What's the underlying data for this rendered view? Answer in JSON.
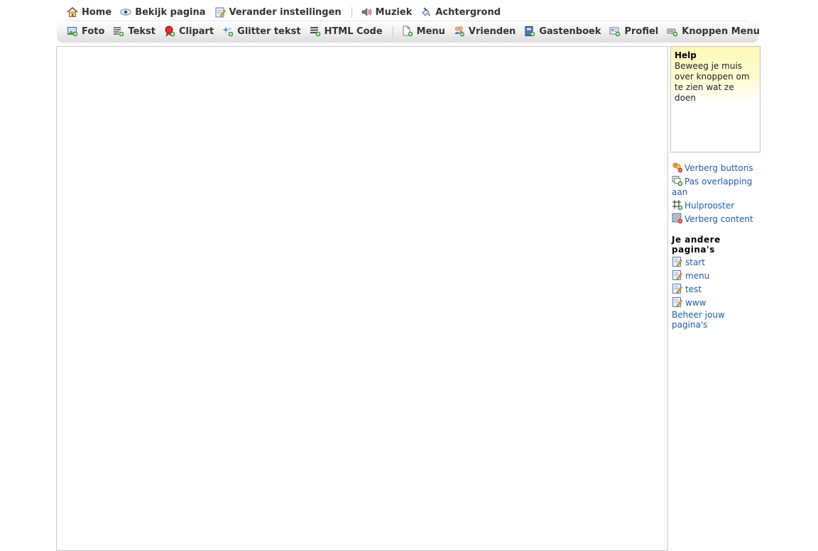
{
  "toolbar": {
    "row1": [
      {
        "label": "Home",
        "icon": "home-icon"
      },
      {
        "label": "Bekijk pagina",
        "icon": "eye-icon"
      },
      {
        "label": "Verander instellingen",
        "icon": "edit-icon"
      },
      {
        "label": "Muziek",
        "icon": "speaker-icon"
      },
      {
        "label": "Achtergrond",
        "icon": "paint-icon"
      }
    ],
    "row2": [
      {
        "label": "Foto",
        "icon": "photo-icon"
      },
      {
        "label": "Tekst",
        "icon": "text-icon"
      },
      {
        "label": "Clipart",
        "icon": "clipart-icon"
      },
      {
        "label": "Glitter tekst",
        "icon": "glitter-icon"
      },
      {
        "label": "HTML Code",
        "icon": "code-icon"
      },
      {
        "label": "Menu",
        "icon": "menu-icon"
      },
      {
        "label": "Vrienden",
        "icon": "friends-icon"
      },
      {
        "label": "Gastenboek",
        "icon": "guestbook-icon"
      },
      {
        "label": "Profiel",
        "icon": "profile-icon"
      },
      {
        "label": "Knoppen Menu",
        "icon": "buttons-menu-icon"
      }
    ]
  },
  "help": {
    "title": "Help",
    "text": "Beweeg je muis over knoppen om te zien wat ze doen"
  },
  "tools": {
    "hide_buttons": "Verberg buttons",
    "overlap": "Pas overlapping aan",
    "grid": "Hulprooster",
    "hide_content": "Verberg content"
  },
  "pages": {
    "title": "Je andere pagina's",
    "items": [
      "start",
      "menu",
      "test",
      "www"
    ],
    "manage": "Beheer jouw pagina's"
  },
  "colors": {
    "link": "#1f5da8",
    "help_bg": "#fff9b8",
    "toolbar_text": "#333333"
  }
}
